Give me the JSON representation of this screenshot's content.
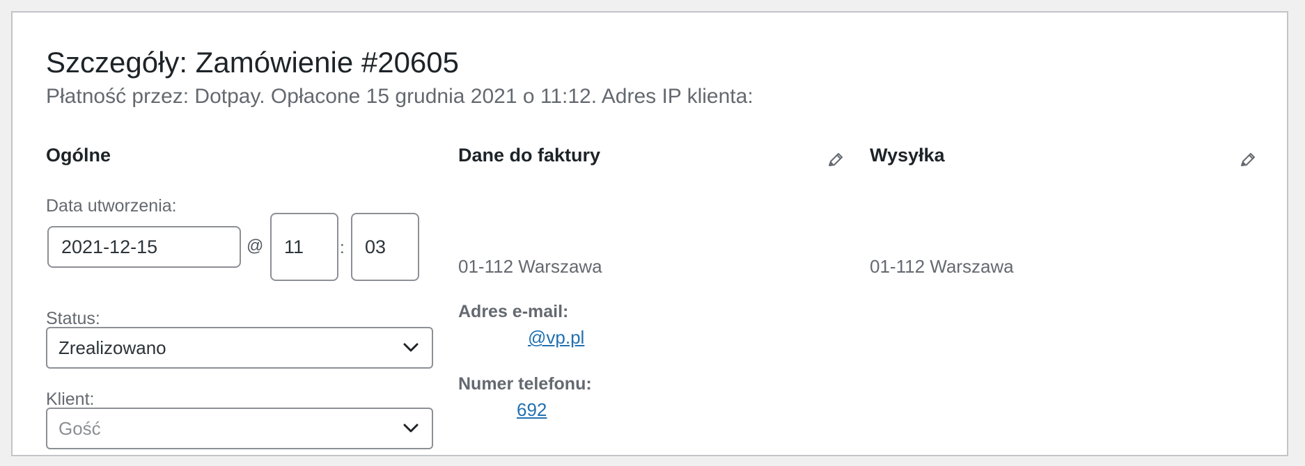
{
  "order": {
    "title": "Szczegóły: Zamówienie #20605",
    "subtitle": "Płatność przez: Dotpay. Opłacone 15 grudnia 2021 o 11:12. Adres IP klienta:"
  },
  "general": {
    "heading": "Ogólne",
    "date_label": "Data utworzenia:",
    "date_value": "2021-12-15",
    "at_symbol": "@",
    "hour_value": "11",
    "colon": ":",
    "minute_value": "03",
    "status_label": "Status:",
    "status_value": "Zrealizowano",
    "customer_label": "Klient:",
    "customer_value": "Gość"
  },
  "billing": {
    "heading": "Dane do faktury",
    "edit_icon": "pencil-icon",
    "address_line": "01-112 Warszawa",
    "email_label": "Adres e-mail:",
    "email_value": "@vp.pl",
    "phone_label": "Numer telefonu:",
    "phone_value": "692"
  },
  "shipping": {
    "heading": "Wysyłka",
    "edit_icon": "pencil-icon",
    "address_line": "01-112 Warszawa"
  },
  "colors": {
    "link": "#2271b1",
    "muted_text": "#646970",
    "border": "#8c8f94"
  }
}
